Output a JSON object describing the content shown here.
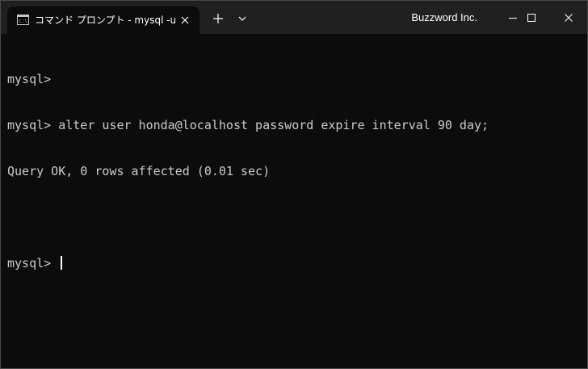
{
  "window": {
    "tab_title": "コマンド プロンプト - mysql  -u roo",
    "brand": "Buzzword Inc.",
    "tab_icon": "terminal-icon",
    "close_icon": "close-icon",
    "new_tab_icon": "plus-icon",
    "dropdown_icon": "chevron-down-icon"
  },
  "terminal": {
    "lines": [
      "mysql>",
      "mysql> alter user honda@localhost password expire interval 90 day;",
      "Query OK, 0 rows affected (0.01 sec)",
      "",
      "mysql> "
    ]
  },
  "colors": {
    "titlebar": "#202020",
    "background": "#0c0c0c",
    "text": "#cccccc"
  }
}
